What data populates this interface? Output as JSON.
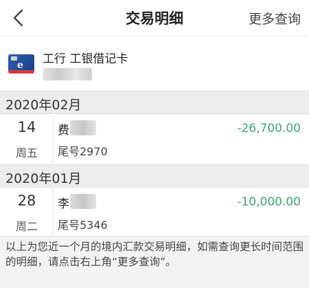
{
  "nav": {
    "title": "交易明细",
    "more_label": "更多查询"
  },
  "card": {
    "icon": "debit-card-icon",
    "name": "工行 工银借记卡"
  },
  "groups": [
    {
      "month": "2020年02月",
      "transactions": [
        {
          "day": "14",
          "weekday": "周五",
          "name": "费",
          "tail": "尾号2970",
          "amount": "-26,700.00"
        }
      ]
    },
    {
      "month": "2020年01月",
      "transactions": [
        {
          "day": "28",
          "weekday": "周二",
          "name": "李",
          "tail": "尾号5346",
          "amount": "-10,000.00"
        }
      ]
    }
  ],
  "footer": {
    "note": "以上为您近一个月的境内汇款交易明细，如需查询更长时间范围的明细，请点击右上角“更多查询”。"
  },
  "colors": {
    "amount": "#3aa86b",
    "section_bg": "#ececec",
    "footer_bg": "#f2f2f2"
  }
}
